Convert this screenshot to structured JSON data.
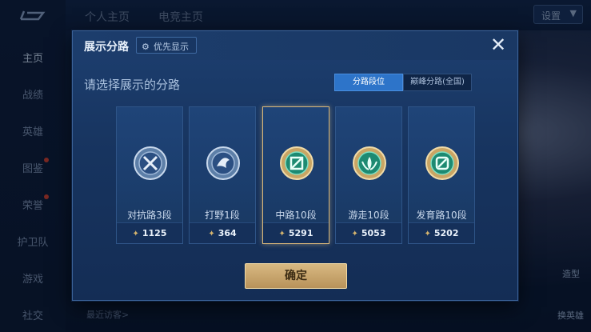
{
  "sidebar": {
    "items": [
      {
        "label": "主页",
        "active": true
      },
      {
        "label": "战绩"
      },
      {
        "label": "英雄"
      },
      {
        "label": "图鉴"
      },
      {
        "label": "荣誉"
      },
      {
        "label": "护卫队"
      },
      {
        "label": "游戏"
      },
      {
        "label": "社交"
      }
    ]
  },
  "topnav": {
    "tabs": [
      "个人主页",
      "电竞主页"
    ],
    "settings_label": "设置"
  },
  "background": {
    "recent_visitors_label": "最近访客>",
    "right_labels": [
      "造型",
      "换英雄"
    ]
  },
  "modal": {
    "title": "展示分路",
    "priority_label": "优先显示",
    "close_icon": "close-icon",
    "prompt": "请选择展示的分路",
    "segments": [
      "分路段位",
      "巅峰分路(全国)"
    ],
    "active_segment": "分路段位",
    "cards": [
      {
        "name": "对抗路3段",
        "score": "1125",
        "icon": "clash-lane-icon"
      },
      {
        "name": "打野1段",
        "score": "364",
        "icon": "jungle-icon"
      },
      {
        "name": "中路10段",
        "score": "5291",
        "icon": "mid-lane-icon",
        "selected": true
      },
      {
        "name": "游走10段",
        "score": "5053",
        "icon": "roam-icon"
      },
      {
        "name": "发育路10段",
        "score": "5202",
        "icon": "farm-lane-icon"
      }
    ],
    "confirm_label": "确定"
  },
  "colors": {
    "accent_gold": "#d8b982",
    "segment_active": "#2d74c9",
    "modal_bg": "#1d3f70"
  }
}
